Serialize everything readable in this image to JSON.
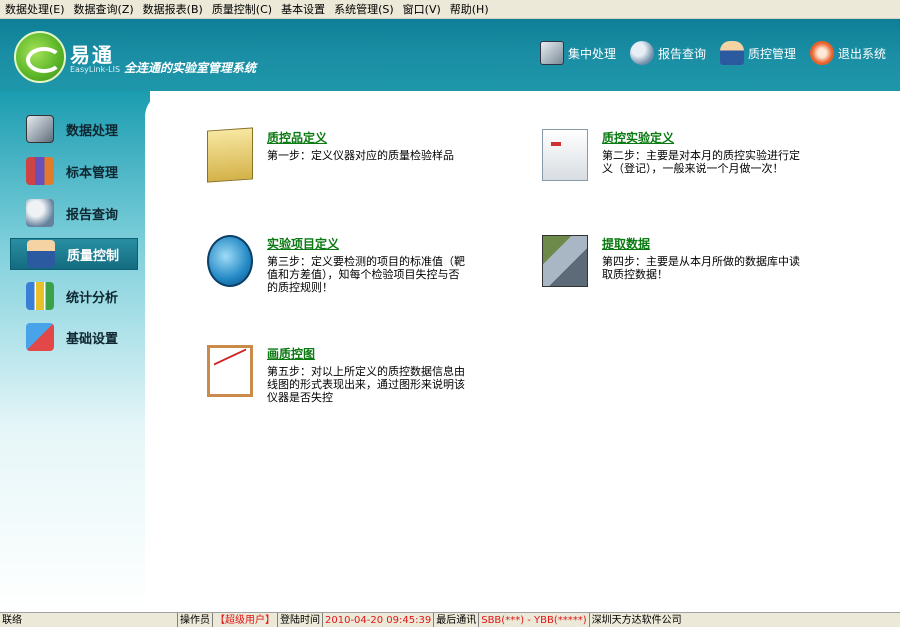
{
  "menu": [
    {
      "label": "数据处理(E)"
    },
    {
      "label": "数据查询(Z)"
    },
    {
      "label": "数据报表(B)"
    },
    {
      "label": "质量控制(C)"
    },
    {
      "label": "基本设置"
    },
    {
      "label": "系统管理(S)"
    },
    {
      "label": "窗口(V)"
    },
    {
      "label": "帮助(H)"
    }
  ],
  "header": {
    "brand": "易通",
    "brand_sub": "EasyLink-LIS",
    "slogan": "全连通的实验室管理系统",
    "tools": [
      {
        "label": "集中处理",
        "icon": "computer-icon"
      },
      {
        "label": "报告查询",
        "icon": "magnifier-icon"
      },
      {
        "label": "质控管理",
        "icon": "doctor-icon"
      },
      {
        "label": "退出系统",
        "icon": "exit-icon"
      }
    ]
  },
  "sidebar": {
    "items": [
      {
        "label": "数据处理",
        "icon": "computer-icon"
      },
      {
        "label": "标本管理",
        "icon": "test-tubes-icon"
      },
      {
        "label": "报告查询",
        "icon": "magnifier-icon"
      },
      {
        "label": "质量控制",
        "icon": "doctor-icon",
        "active": true
      },
      {
        "label": "统计分析",
        "icon": "bar-chart-icon"
      },
      {
        "label": "基础设置",
        "icon": "cubes-icon"
      }
    ]
  },
  "tasks": [
    {
      "title": "质控品定义",
      "desc": "第一步：定义仪器对应的质量检验样品",
      "icon": "note-paper-icon"
    },
    {
      "title": "质控实验定义",
      "desc": "第二步：主要是对本月的质控实验进行定义（登记），一般来说一个月做一次！",
      "icon": "document-icon"
    },
    {
      "title": "实验项目定义",
      "desc": "第三步：定义要检测的项目的标准值（靶值和方差值），知每个检验项目失控与否的质控规则！",
      "icon": "settings-globe-icon"
    },
    {
      "title": "提取数据",
      "desc": "第四步：主要是从本月所做的数据库中读取质控数据！",
      "icon": "server-icon"
    },
    {
      "title": "画质控图",
      "desc": "第五步：对以上所定义的质控数据信息由线图的形式表现出来，通过图形来说明该仪器是否失控",
      "icon": "line-chart-icon"
    }
  ],
  "status": {
    "ready": "联络",
    "operator_label": "操作员",
    "operator_value": "【超级用户】",
    "login_label": "登陆时间",
    "login_value": "2010-04-20 09:45:39",
    "comm_label": "最后通讯",
    "comm_value": "SBB(***) - YBB(*****)",
    "company": "深圳天方达软件公司"
  }
}
